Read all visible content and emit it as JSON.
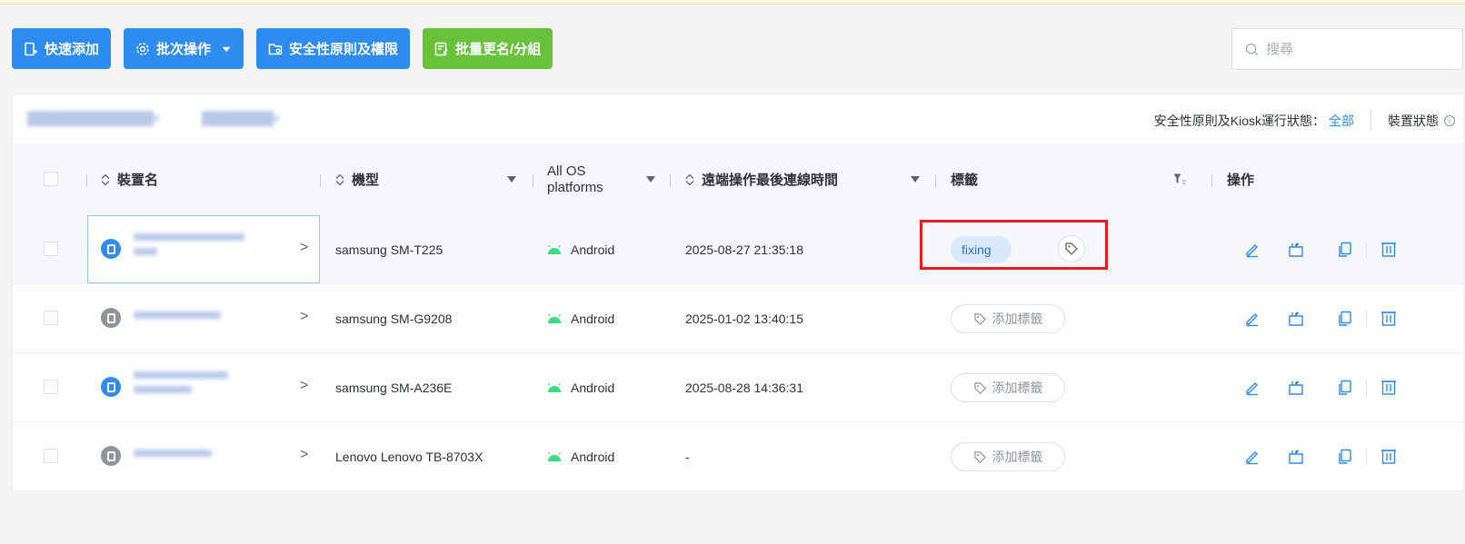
{
  "toolbar": {
    "quick_add": "快速添加",
    "batch_ops": "批次操作",
    "security": "安全性原則及權限",
    "rename_group": "批量更名/分組"
  },
  "search": {
    "placeholder": "搜尋"
  },
  "status_bar": {
    "label": "安全性原則及Kiosk運行狀態：",
    "value": "全部",
    "device_status": "裝置狀態"
  },
  "columns": {
    "name": "裝置名",
    "model": "機型",
    "os_line1": "All OS",
    "os_line2": "platforms",
    "last_online": "遠端操作最後連線時間",
    "tags": "標籤",
    "actions": "操作"
  },
  "rows": [
    {
      "model": "samsung SM-T225",
      "os": "Android",
      "last_online": "2025-08-27 21:35:18",
      "tag": "fixing"
    },
    {
      "model": "samsung SM-G9208",
      "os": "Android",
      "last_online": "2025-01-02 13:40:15",
      "add_tag": "添加標籤"
    },
    {
      "model": "samsung SM-A236E",
      "os": "Android",
      "last_online": "2025-08-28 14:36:31",
      "add_tag": "添加標籤"
    },
    {
      "model": "Lenovo Lenovo TB-8703X",
      "os": "Android",
      "last_online": "-",
      "add_tag": "添加標籤"
    }
  ],
  "colors": {
    "primary": "#2d8cf0",
    "success": "#67c23a",
    "highlight_box": "#e11d20",
    "android": "#3ddc84"
  }
}
